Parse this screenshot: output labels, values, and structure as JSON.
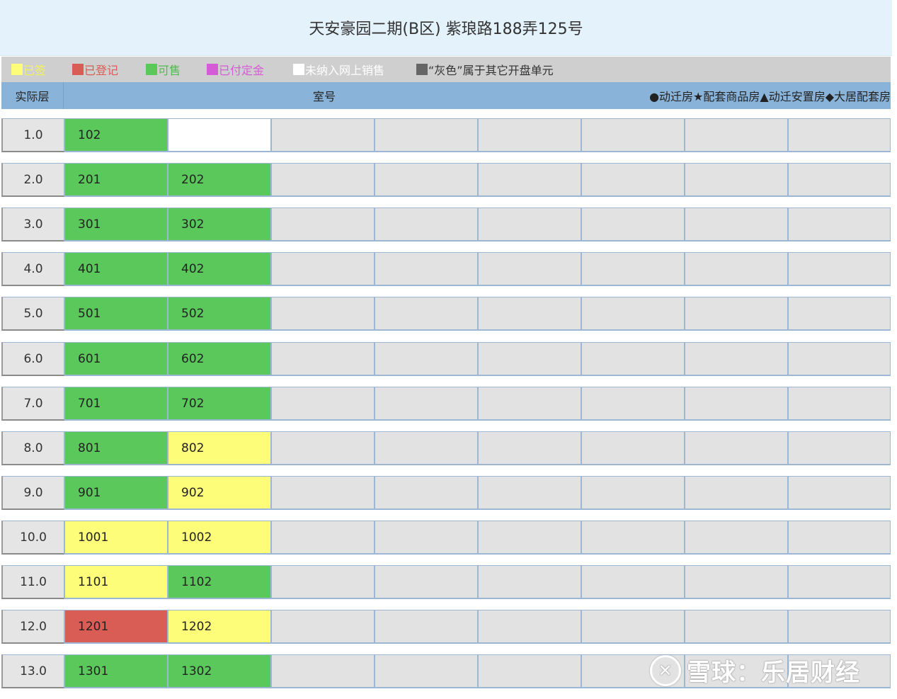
{
  "title": "天安豪园二期(B区) 紫琅路188弄125号",
  "legend": [
    {
      "label": "已签",
      "color": "#fdfd7a",
      "text_color": "#f2f25a"
    },
    {
      "label": "已登记",
      "color": "#d95c55",
      "text_color": "#d95c55"
    },
    {
      "label": "可售",
      "color": "#5ac85a",
      "text_color": "#4cbd4c"
    },
    {
      "label": "已付定金",
      "color": "#d65bd6",
      "text_color": "#d65bd6"
    },
    {
      "label": "未纳入网上销售",
      "color": "#ffffff",
      "text_color": "#ffffff"
    },
    {
      "label": "“灰色”属于其它开盘单元",
      "color": "#666666",
      "text_color": "#333333"
    }
  ],
  "header": {
    "floor": "实际层",
    "room": "室号",
    "types": "●动迁房★配套商品房▲动迁安置房◆大居配套房"
  },
  "floors": [
    {
      "floor": "1.0",
      "rooms": [
        {
          "no": "102",
          "status": "green"
        },
        {
          "no": "",
          "status": "white"
        }
      ]
    },
    {
      "floor": "2.0",
      "rooms": [
        {
          "no": "201",
          "status": "green"
        },
        {
          "no": "202",
          "status": "green"
        }
      ]
    },
    {
      "floor": "3.0",
      "rooms": [
        {
          "no": "301",
          "status": "green"
        },
        {
          "no": "302",
          "status": "green"
        }
      ]
    },
    {
      "floor": "4.0",
      "rooms": [
        {
          "no": "401",
          "status": "green"
        },
        {
          "no": "402",
          "status": "green"
        }
      ]
    },
    {
      "floor": "5.0",
      "rooms": [
        {
          "no": "501",
          "status": "green"
        },
        {
          "no": "502",
          "status": "green"
        }
      ]
    },
    {
      "floor": "6.0",
      "rooms": [
        {
          "no": "601",
          "status": "green"
        },
        {
          "no": "602",
          "status": "green"
        }
      ]
    },
    {
      "floor": "7.0",
      "rooms": [
        {
          "no": "701",
          "status": "green"
        },
        {
          "no": "702",
          "status": "green"
        }
      ]
    },
    {
      "floor": "8.0",
      "rooms": [
        {
          "no": "801",
          "status": "green"
        },
        {
          "no": "802",
          "status": "yellow"
        }
      ]
    },
    {
      "floor": "9.0",
      "rooms": [
        {
          "no": "901",
          "status": "green"
        },
        {
          "no": "902",
          "status": "yellow"
        }
      ]
    },
    {
      "floor": "10.0",
      "rooms": [
        {
          "no": "1001",
          "status": "yellow"
        },
        {
          "no": "1002",
          "status": "yellow"
        }
      ]
    },
    {
      "floor": "11.0",
      "rooms": [
        {
          "no": "1101",
          "status": "yellow"
        },
        {
          "no": "1102",
          "status": "green"
        }
      ]
    },
    {
      "floor": "12.0",
      "rooms": [
        {
          "no": "1201",
          "status": "red"
        },
        {
          "no": "1202",
          "status": "yellow"
        }
      ]
    },
    {
      "floor": "13.0",
      "rooms": [
        {
          "no": "1301",
          "status": "green"
        },
        {
          "no": "1302",
          "status": "green"
        }
      ]
    }
  ],
  "watermark": "雪球：乐居财经"
}
